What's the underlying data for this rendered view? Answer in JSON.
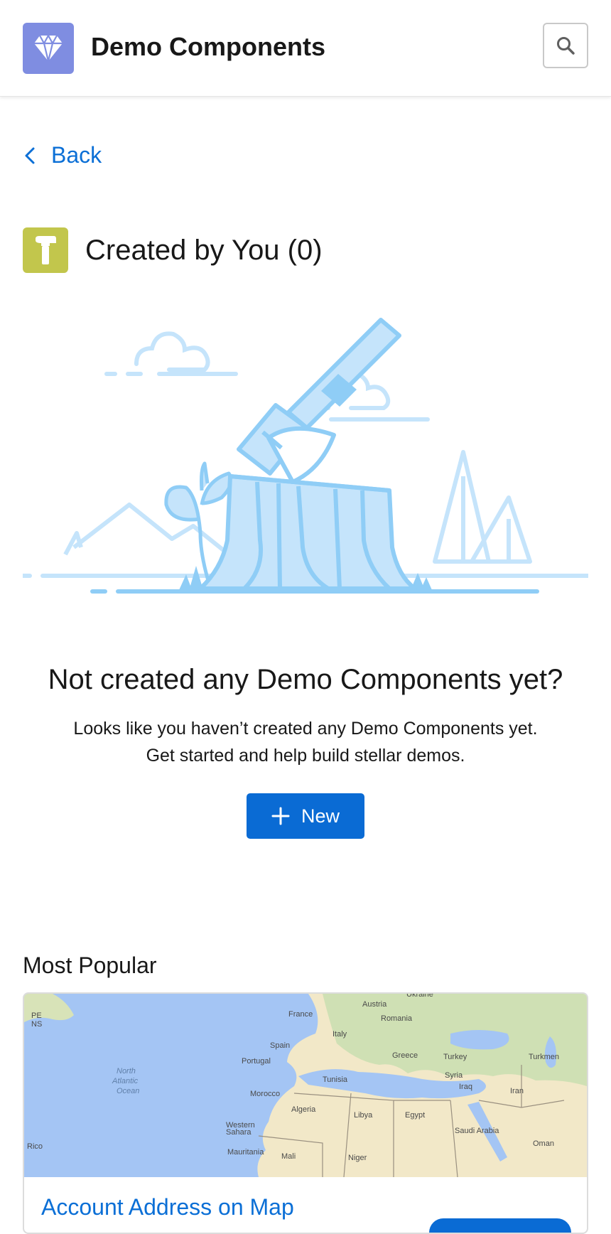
{
  "header": {
    "app_title": "Demo Components",
    "app_icon": "diamond-icon",
    "app_icon_color": "#7f8de1",
    "search_icon": "search-icon"
  },
  "nav": {
    "back_label": "Back"
  },
  "section": {
    "title": "Created by You (0)",
    "icon": "hammer-icon",
    "icon_color": "#c2c64c"
  },
  "empty_state": {
    "heading": "Not created any Demo Components yet?",
    "body_line1": "Looks like you haven’t created any Demo Components yet.",
    "body_line2": "Get started and help build stellar demos.",
    "new_button_label": "New"
  },
  "popular": {
    "title": "Most Popular",
    "cards": [
      {
        "title": "Account Address on Map",
        "map_labels": {
          "ocean": [
            "North",
            "Atlantic",
            "Ocean"
          ],
          "countries": [
            "Ukraine",
            "Austria",
            "France",
            "Romania",
            "Italy",
            "Spain",
            "Portugal",
            "Greece",
            "Turkey",
            "Turkmen",
            "Syria",
            "Iraq",
            "Iran",
            "Tunisia",
            "Morocco",
            "Algeria",
            "Libya",
            "Egypt",
            "Western Sahara",
            "Saudi Arabia",
            "Oman",
            "Mauritania",
            "Mali",
            "Niger",
            "Rico",
            "PE",
            "NS"
          ]
        }
      }
    ]
  },
  "colors": {
    "brand_blue": "#0a6bd4",
    "link_blue": "#0b6fd6",
    "illustration_light": "#c5e4fb",
    "illustration_stroke": "#8fcdf6"
  }
}
